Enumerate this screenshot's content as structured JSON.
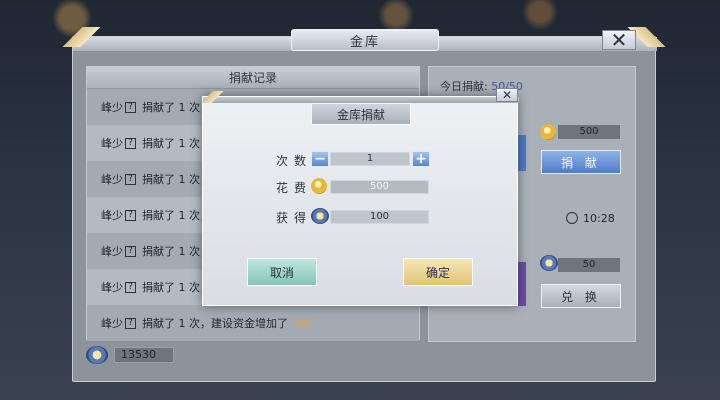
{
  "window": {
    "title": "金库",
    "close_label": "✕"
  },
  "log": {
    "header": "捐献记录",
    "rows": [
      {
        "name": "峰少",
        "q": "?",
        "text": "捐献了  1  次，建设资金增加了"
      },
      {
        "name": "峰少",
        "q": "?",
        "text": "捐献了  1  次，建设资金增加了"
      },
      {
        "name": "峰少",
        "q": "?",
        "text": "捐献了  1  次，建设资金增加了"
      },
      {
        "name": "峰少",
        "q": "?",
        "text": "捐献了  1  次，建设资金增加了"
      },
      {
        "name": "峰少",
        "q": "?",
        "text": "捐献了  1  次，建设资金增加了"
      },
      {
        "name": "峰少",
        "q": "?",
        "text": "捐献了  1  次，建设资金增加了"
      },
      {
        "name": "峰少",
        "q": "?",
        "text": "捐献了  1  次，建设资金增加了",
        "amount": "500"
      }
    ]
  },
  "funds": {
    "value": "13530"
  },
  "right": {
    "today_label": "今日捐献:",
    "today_value": "50/50",
    "cost_value": "500",
    "donate_label": "捐 献",
    "time": "10:28",
    "exchange_value": "50",
    "exchange_label": "兑 换"
  },
  "dialog": {
    "title": "金库捐献",
    "close_label": "✕",
    "count_label": "次数",
    "count_value": "1",
    "minus_label": "−",
    "plus_label": "+",
    "cost_label": "花费",
    "cost_value": "500",
    "gain_label": "获得",
    "gain_value": "100",
    "cancel_label": "取消",
    "confirm_label": "确定"
  },
  "colors": {
    "accent_blue": "#4f7cc6",
    "gold": "#e4a733",
    "cancel_green": "#86c5b8",
    "confirm_yellow": "#e1c47a"
  }
}
